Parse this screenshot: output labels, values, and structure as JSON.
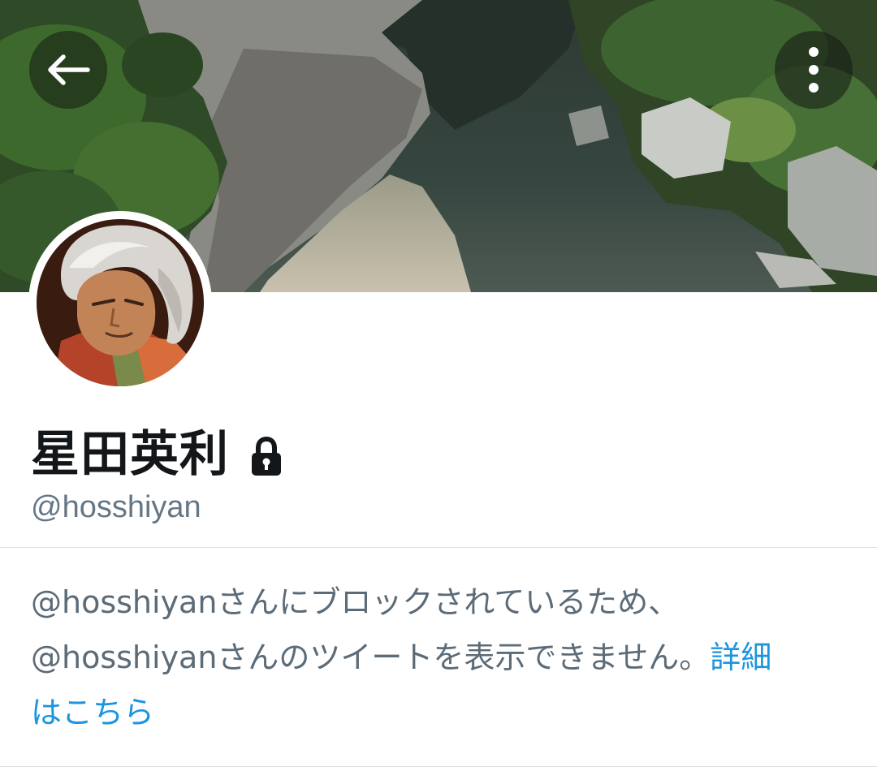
{
  "header": {
    "back_icon": "arrow-left-icon",
    "more_icon": "vertical-dots-icon"
  },
  "profile": {
    "display_name": "星田英利",
    "lock_icon": "lock-icon",
    "handle": "@hosshiyan"
  },
  "notice": {
    "line1": "@hosshiyanさんにブロックされているため、",
    "line2": "@hosshiyanさんのツイートを表示できません。",
    "link_part1": "詳細",
    "link_part2": "はこちら"
  },
  "colors": {
    "link": "#1b95e0",
    "secondary_text": "#657786",
    "primary_text": "#14171a"
  }
}
